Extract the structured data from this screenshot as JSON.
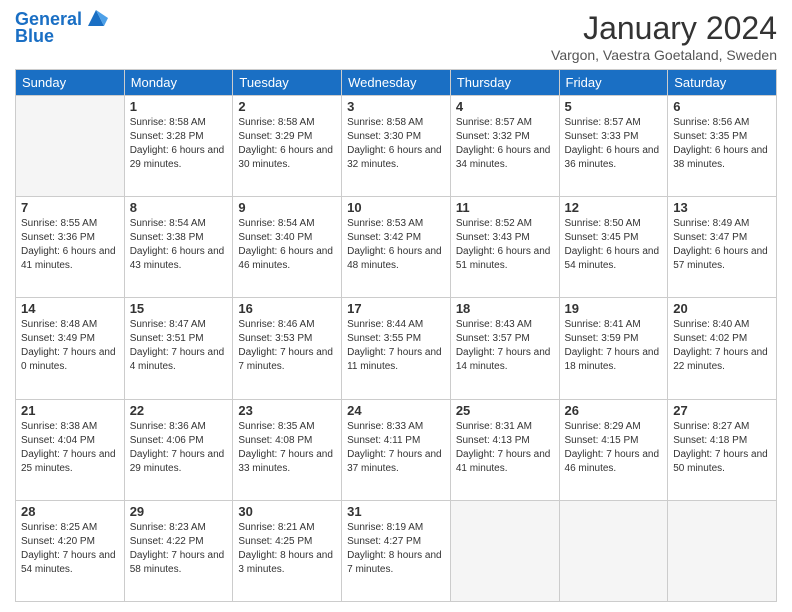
{
  "header": {
    "logo_line1": "General",
    "logo_line2": "Blue",
    "month_title": "January 2024",
    "subtitle": "Vargon, Vaestra Goetaland, Sweden"
  },
  "days_of_week": [
    "Sunday",
    "Monday",
    "Tuesday",
    "Wednesday",
    "Thursday",
    "Friday",
    "Saturday"
  ],
  "weeks": [
    [
      {
        "day": "",
        "empty": true
      },
      {
        "day": "1",
        "sunrise": "Sunrise: 8:58 AM",
        "sunset": "Sunset: 3:28 PM",
        "daylight": "Daylight: 6 hours and 29 minutes."
      },
      {
        "day": "2",
        "sunrise": "Sunrise: 8:58 AM",
        "sunset": "Sunset: 3:29 PM",
        "daylight": "Daylight: 6 hours and 30 minutes."
      },
      {
        "day": "3",
        "sunrise": "Sunrise: 8:58 AM",
        "sunset": "Sunset: 3:30 PM",
        "daylight": "Daylight: 6 hours and 32 minutes."
      },
      {
        "day": "4",
        "sunrise": "Sunrise: 8:57 AM",
        "sunset": "Sunset: 3:32 PM",
        "daylight": "Daylight: 6 hours and 34 minutes."
      },
      {
        "day": "5",
        "sunrise": "Sunrise: 8:57 AM",
        "sunset": "Sunset: 3:33 PM",
        "daylight": "Daylight: 6 hours and 36 minutes."
      },
      {
        "day": "6",
        "sunrise": "Sunrise: 8:56 AM",
        "sunset": "Sunset: 3:35 PM",
        "daylight": "Daylight: 6 hours and 38 minutes."
      }
    ],
    [
      {
        "day": "7",
        "sunrise": "Sunrise: 8:55 AM",
        "sunset": "Sunset: 3:36 PM",
        "daylight": "Daylight: 6 hours and 41 minutes."
      },
      {
        "day": "8",
        "sunrise": "Sunrise: 8:54 AM",
        "sunset": "Sunset: 3:38 PM",
        "daylight": "Daylight: 6 hours and 43 minutes."
      },
      {
        "day": "9",
        "sunrise": "Sunrise: 8:54 AM",
        "sunset": "Sunset: 3:40 PM",
        "daylight": "Daylight: 6 hours and 46 minutes."
      },
      {
        "day": "10",
        "sunrise": "Sunrise: 8:53 AM",
        "sunset": "Sunset: 3:42 PM",
        "daylight": "Daylight: 6 hours and 48 minutes."
      },
      {
        "day": "11",
        "sunrise": "Sunrise: 8:52 AM",
        "sunset": "Sunset: 3:43 PM",
        "daylight": "Daylight: 6 hours and 51 minutes."
      },
      {
        "day": "12",
        "sunrise": "Sunrise: 8:50 AM",
        "sunset": "Sunset: 3:45 PM",
        "daylight": "Daylight: 6 hours and 54 minutes."
      },
      {
        "day": "13",
        "sunrise": "Sunrise: 8:49 AM",
        "sunset": "Sunset: 3:47 PM",
        "daylight": "Daylight: 6 hours and 57 minutes."
      }
    ],
    [
      {
        "day": "14",
        "sunrise": "Sunrise: 8:48 AM",
        "sunset": "Sunset: 3:49 PM",
        "daylight": "Daylight: 7 hours and 0 minutes."
      },
      {
        "day": "15",
        "sunrise": "Sunrise: 8:47 AM",
        "sunset": "Sunset: 3:51 PM",
        "daylight": "Daylight: 7 hours and 4 minutes."
      },
      {
        "day": "16",
        "sunrise": "Sunrise: 8:46 AM",
        "sunset": "Sunset: 3:53 PM",
        "daylight": "Daylight: 7 hours and 7 minutes."
      },
      {
        "day": "17",
        "sunrise": "Sunrise: 8:44 AM",
        "sunset": "Sunset: 3:55 PM",
        "daylight": "Daylight: 7 hours and 11 minutes."
      },
      {
        "day": "18",
        "sunrise": "Sunrise: 8:43 AM",
        "sunset": "Sunset: 3:57 PM",
        "daylight": "Daylight: 7 hours and 14 minutes."
      },
      {
        "day": "19",
        "sunrise": "Sunrise: 8:41 AM",
        "sunset": "Sunset: 3:59 PM",
        "daylight": "Daylight: 7 hours and 18 minutes."
      },
      {
        "day": "20",
        "sunrise": "Sunrise: 8:40 AM",
        "sunset": "Sunset: 4:02 PM",
        "daylight": "Daylight: 7 hours and 22 minutes."
      }
    ],
    [
      {
        "day": "21",
        "sunrise": "Sunrise: 8:38 AM",
        "sunset": "Sunset: 4:04 PM",
        "daylight": "Daylight: 7 hours and 25 minutes."
      },
      {
        "day": "22",
        "sunrise": "Sunrise: 8:36 AM",
        "sunset": "Sunset: 4:06 PM",
        "daylight": "Daylight: 7 hours and 29 minutes."
      },
      {
        "day": "23",
        "sunrise": "Sunrise: 8:35 AM",
        "sunset": "Sunset: 4:08 PM",
        "daylight": "Daylight: 7 hours and 33 minutes."
      },
      {
        "day": "24",
        "sunrise": "Sunrise: 8:33 AM",
        "sunset": "Sunset: 4:11 PM",
        "daylight": "Daylight: 7 hours and 37 minutes."
      },
      {
        "day": "25",
        "sunrise": "Sunrise: 8:31 AM",
        "sunset": "Sunset: 4:13 PM",
        "daylight": "Daylight: 7 hours and 41 minutes."
      },
      {
        "day": "26",
        "sunrise": "Sunrise: 8:29 AM",
        "sunset": "Sunset: 4:15 PM",
        "daylight": "Daylight: 7 hours and 46 minutes."
      },
      {
        "day": "27",
        "sunrise": "Sunrise: 8:27 AM",
        "sunset": "Sunset: 4:18 PM",
        "daylight": "Daylight: 7 hours and 50 minutes."
      }
    ],
    [
      {
        "day": "28",
        "sunrise": "Sunrise: 8:25 AM",
        "sunset": "Sunset: 4:20 PM",
        "daylight": "Daylight: 7 hours and 54 minutes."
      },
      {
        "day": "29",
        "sunrise": "Sunrise: 8:23 AM",
        "sunset": "Sunset: 4:22 PM",
        "daylight": "Daylight: 7 hours and 58 minutes."
      },
      {
        "day": "30",
        "sunrise": "Sunrise: 8:21 AM",
        "sunset": "Sunset: 4:25 PM",
        "daylight": "Daylight: 8 hours and 3 minutes."
      },
      {
        "day": "31",
        "sunrise": "Sunrise: 8:19 AM",
        "sunset": "Sunset: 4:27 PM",
        "daylight": "Daylight: 8 hours and 7 minutes."
      },
      {
        "day": "",
        "empty": true
      },
      {
        "day": "",
        "empty": true
      },
      {
        "day": "",
        "empty": true
      }
    ]
  ]
}
